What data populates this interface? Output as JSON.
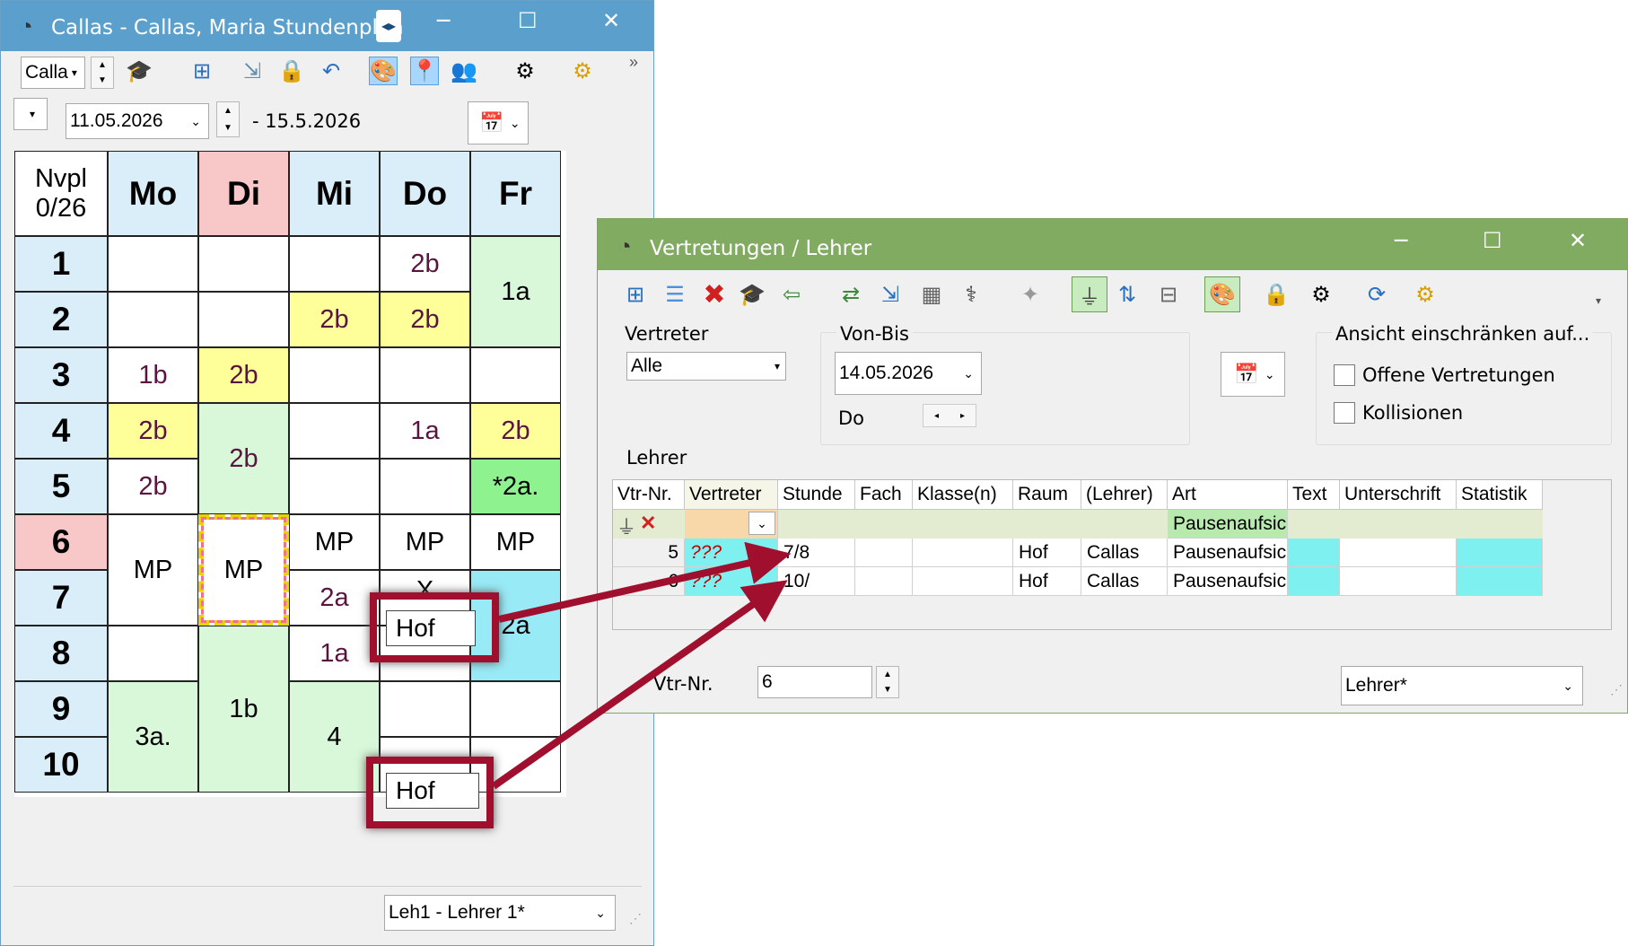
{
  "timetable_window": {
    "title": "Callas - Callas, Maria  Stundenplan",
    "element_select": "Calla",
    "date_from": "11.05.2026",
    "date_to": "- 15.5.2026",
    "corner_line1": "Nvpl",
    "corner_line2": "0/26",
    "days": [
      "Mo",
      "Di",
      "Mi",
      "Do",
      "Fr"
    ],
    "hours": [
      "1",
      "2",
      "3",
      "4",
      "5",
      "6",
      "7",
      "8",
      "9",
      "10"
    ],
    "lessons": {
      "do_1": "2b",
      "fr_12": "1a",
      "mi_2": "2b",
      "do_2": "2b",
      "mo_3": "1b",
      "di_3": "2b",
      "mo_4": "2b",
      "di_45": "2b",
      "do_4": "1a",
      "fr_4": "2b",
      "mo_5": "2b",
      "fr_5": "*2a.",
      "mo_67": "MP",
      "di_67": "MP",
      "mi_6": "MP",
      "do_6": "MP",
      "fr_6": "MP",
      "mi_7": "2a",
      "do_7": "X",
      "fr_78": "2a",
      "mi_8": "1a",
      "mo_910": "3a.",
      "di_810": "1b",
      "mi_910": "4"
    },
    "callout_top": "Hof",
    "callout_bottom": "Hof",
    "footer_select": "Leh1 - Lehrer 1*"
  },
  "substitution_window": {
    "title": "Vertretungen / Lehrer",
    "vertreter_label": "Vertreter",
    "vertreter_value": "Alle",
    "vonbis_label": "Von-Bis",
    "vonbis_value": "14.05.2026",
    "day_label": "Do",
    "restrict_label": "Ansicht einschränken auf...",
    "check_open": "Offene Vertretungen",
    "check_collisions": "Kollisionen",
    "grid_title": "Lehrer",
    "columns": [
      "Vtr-Nr.",
      "Vertreter",
      "Stunde",
      "Fach",
      "Klasse(n)",
      "Raum",
      "(Lehrer)",
      "Art",
      "Text",
      "Unterschrift",
      "Statistik"
    ],
    "filter_art": "Pausenaufsic",
    "rows": [
      {
        "nr": "5",
        "vertreter": "???",
        "stunde": "7/8",
        "fach": "",
        "klasse": "",
        "raum": "Hof",
        "lehrer": "Callas",
        "art": "Pausenaufsic"
      },
      {
        "nr": "6",
        "vertreter": "???",
        "stunde": "10/",
        "fach": "",
        "klasse": "",
        "raum": "Hof",
        "lehrer": "Callas",
        "art": "Pausenaufsic"
      }
    ],
    "vtr_nr_label": "Vtr-Nr.",
    "vtr_nr_value": "6",
    "footer_select": "Lehrer*"
  },
  "colors": {
    "left_title": "#5ba0cc",
    "right_title": "#82ab62",
    "arrow": "#a0102e",
    "highlight_yellow": "#ffff99",
    "highlight_green": "#d9f7d9",
    "highlight_cyan": "#99eaf7"
  }
}
